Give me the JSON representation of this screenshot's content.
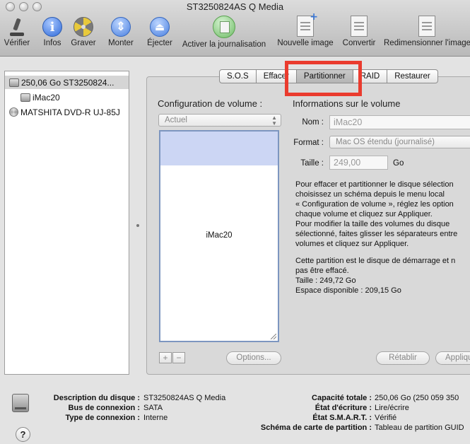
{
  "window": {
    "title": "ST3250824AS Q Media"
  },
  "toolbar": {
    "items": [
      {
        "label": "Vérifier",
        "icon": "microscope-icon"
      },
      {
        "label": "Infos",
        "icon": "info-icon"
      },
      {
        "label": "Graver",
        "icon": "burn-icon"
      },
      {
        "label": "Monter",
        "icon": "mount-icon"
      },
      {
        "label": "Éjecter",
        "icon": "eject-icon"
      },
      {
        "label": "Activer la journalisation",
        "icon": "journaling-icon"
      },
      {
        "label": "Nouvelle image",
        "icon": "new-image-icon"
      },
      {
        "label": "Convertir",
        "icon": "convert-icon"
      },
      {
        "label": "Redimensionner l'image",
        "icon": "resize-image-icon"
      }
    ]
  },
  "sidebar": {
    "disks": [
      {
        "label": "250,06 Go ST3250824...",
        "type": "disk",
        "selected": true
      },
      {
        "label": "iMac20",
        "type": "volume",
        "selected": false
      },
      {
        "label": "MATSHITA DVD-R UJ-85J",
        "type": "optical",
        "selected": false
      }
    ]
  },
  "tabs": [
    {
      "label": "S.O.S",
      "active": false
    },
    {
      "label": "Effacer",
      "active": false
    },
    {
      "label": "Partitionner",
      "active": true
    },
    {
      "label": "RAID",
      "active": false
    },
    {
      "label": "Restaurer",
      "active": false
    }
  ],
  "partition": {
    "config_title": "Configuration de volume :",
    "layout_value": "Actuel",
    "volume_name": "iMac20",
    "add_label": "+",
    "remove_label": "−",
    "options_label": "Options...",
    "info_title": "Informations sur le volume",
    "name_label": "Nom :",
    "name_value": "iMac20",
    "format_label": "Format :",
    "format_value": "Mac OS étendu (journalisé)",
    "size_label": "Taille :",
    "size_value": "249,00",
    "size_unit": "Go",
    "help_lines": [
      "Pour effacer et partitionner le disque sélection",
      "choisissez un schéma depuis le menu local",
      "« Configuration de volume », réglez les option",
      "chaque volume et cliquez sur Appliquer.",
      "Pour modifier la taille des volumes du disque",
      "sélectionné, faites glisser les séparateurs entre",
      "volumes et cliquez sur Appliquer."
    ],
    "status_lines": [
      "Cette partition est le disque de démarrage et n",
      "pas être effacé.",
      "Taille : 249,72 Go",
      "Espace disponible : 209,15 Go"
    ],
    "revert_label": "Rétablir",
    "apply_label": "Appliquer"
  },
  "details": {
    "left": [
      {
        "key": "Description du disque :",
        "value": "ST3250824AS Q Media"
      },
      {
        "key": "Bus de connexion :",
        "value": "SATA"
      },
      {
        "key": "Type de connexion :",
        "value": "Interne"
      }
    ],
    "right": [
      {
        "key": "Capacité totale :",
        "value": "250,06 Go (250 059 350"
      },
      {
        "key": "État d'écriture :",
        "value": "Lire/écrire"
      },
      {
        "key": "État S.M.A.R.T. :",
        "value": "Vérifié"
      },
      {
        "key": "Schéma de carte de partition :",
        "value": "Tableau de partition GUID"
      }
    ]
  },
  "help_button_label": "?"
}
